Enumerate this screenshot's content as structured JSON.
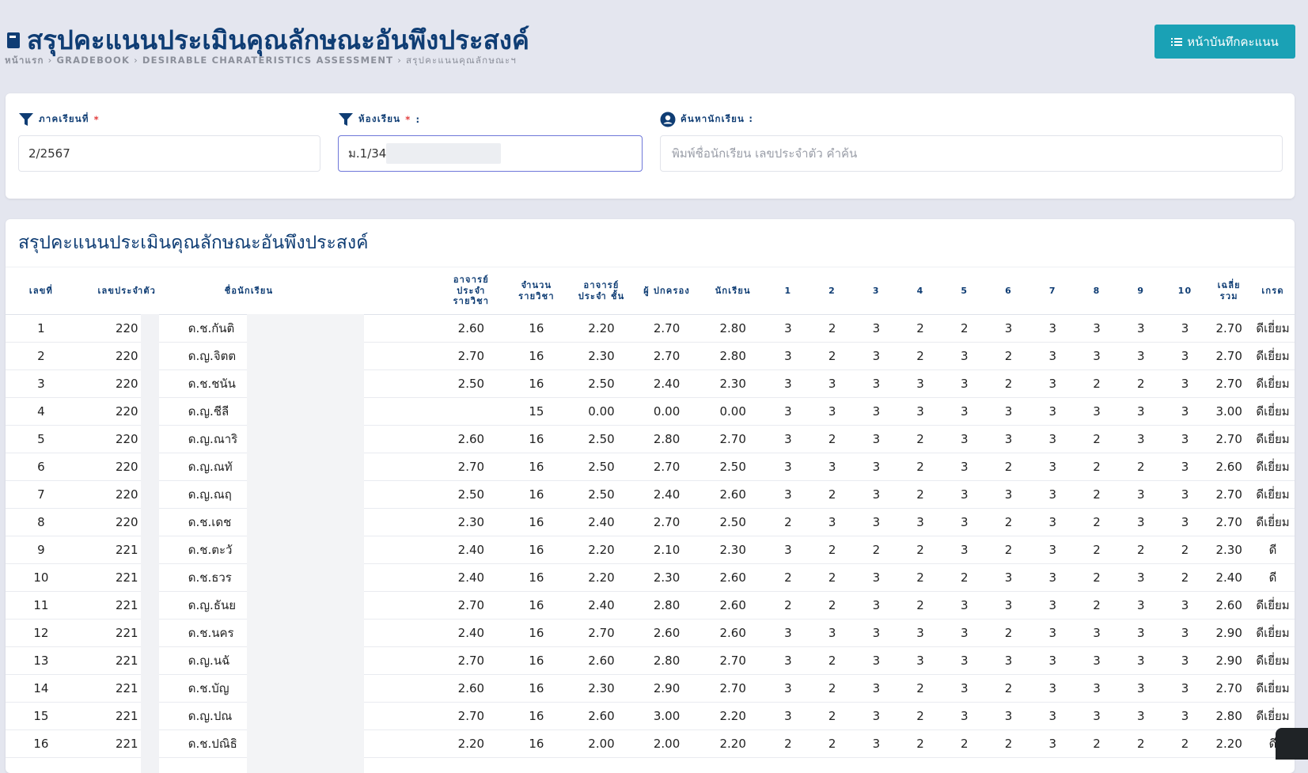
{
  "header": {
    "title": "สรุปคะแนนประเมินคุณลักษณะอันพึงประสงค์",
    "breadcrumb": [
      "หน้าแรก",
      "GRADEBOOK",
      "DESIRABLE CHARATERISTICS ASSESSMENT",
      "สรุปคะแนนคุณลักษณะฯ"
    ],
    "gradebook_button": "หน้าบันทึกคะแนน"
  },
  "filters": {
    "semester": {
      "label": "ภาคเรียนที่",
      "required_mark": "*",
      "value": "2/2567"
    },
    "classroom": {
      "label": "ห้องเรียน",
      "required_mark": "*",
      "suffix": ":",
      "value": "ม.1/34"
    },
    "search": {
      "label": "ค้นหานักเรียน :",
      "placeholder": "พิมพ์ชื่อนักเรียน เลขประจำตัว คำค้น"
    }
  },
  "table": {
    "title": "สรุปคะแนนประเมินคุณลักษณะอันพึงประสงค์",
    "columns": [
      "เลขที่",
      "เลขประจำตัว",
      "ชื่อนักเรียน",
      "อาจารย์ ประจำ รายวิชา",
      "จำนวน รายวิชา",
      "อาจารย์ ประจำ ชั้น",
      "ผู้ ปกครอง",
      "นักเรียน",
      "1",
      "2",
      "3",
      "4",
      "5",
      "6",
      "7",
      "8",
      "9",
      "10",
      "เฉลี่ย รวม",
      "เกรด"
    ],
    "rows": [
      [
        "1",
        "220",
        "ด.ช.กันติ",
        "2.60",
        "16",
        "2.20",
        "2.70",
        "2.80",
        "3",
        "2",
        "3",
        "2",
        "2",
        "3",
        "3",
        "3",
        "3",
        "3",
        "2.70",
        "ดีเยี่ยม"
      ],
      [
        "2",
        "220",
        "ด.ญ.จิตต",
        "2.70",
        "16",
        "2.30",
        "2.70",
        "2.80",
        "3",
        "2",
        "3",
        "2",
        "3",
        "2",
        "3",
        "3",
        "3",
        "3",
        "2.70",
        "ดีเยี่ยม"
      ],
      [
        "3",
        "220",
        "ด.ช.ชนัน",
        "2.50",
        "16",
        "2.50",
        "2.40",
        "2.30",
        "3",
        "3",
        "3",
        "3",
        "3",
        "2",
        "3",
        "2",
        "2",
        "3",
        "2.70",
        "ดีเยี่ยม"
      ],
      [
        "4",
        "220",
        "ด.ญ.ชีลี",
        "",
        "15",
        "0.00",
        "0.00",
        "0.00",
        "3",
        "3",
        "3",
        "3",
        "3",
        "3",
        "3",
        "3",
        "3",
        "3",
        "3.00",
        "ดีเยี่ยม"
      ],
      [
        "5",
        "220",
        "ด.ญ.ณาริ",
        "2.60",
        "16",
        "2.50",
        "2.80",
        "2.70",
        "3",
        "2",
        "3",
        "2",
        "3",
        "3",
        "3",
        "2",
        "3",
        "3",
        "2.70",
        "ดีเยี่ยม"
      ],
      [
        "6",
        "220",
        "ด.ญ.ณทั",
        "2.70",
        "16",
        "2.50",
        "2.70",
        "2.50",
        "3",
        "3",
        "3",
        "2",
        "3",
        "2",
        "3",
        "2",
        "2",
        "3",
        "2.60",
        "ดีเยี่ยม"
      ],
      [
        "7",
        "220",
        "ด.ญ.ณฤ",
        "2.50",
        "16",
        "2.50",
        "2.40",
        "2.60",
        "3",
        "2",
        "3",
        "2",
        "3",
        "3",
        "3",
        "2",
        "3",
        "3",
        "2.70",
        "ดีเยี่ยม"
      ],
      [
        "8",
        "220",
        "ด.ช.เดช",
        "2.30",
        "16",
        "2.40",
        "2.70",
        "2.50",
        "2",
        "3",
        "3",
        "3",
        "3",
        "2",
        "3",
        "2",
        "3",
        "3",
        "2.70",
        "ดีเยี่ยม"
      ],
      [
        "9",
        "221",
        "ด.ช.ตะวั",
        "2.40",
        "16",
        "2.20",
        "2.10",
        "2.30",
        "3",
        "2",
        "2",
        "2",
        "3",
        "2",
        "3",
        "2",
        "2",
        "2",
        "2.30",
        "ดี"
      ],
      [
        "10",
        "221",
        "ด.ช.ธวร",
        "2.40",
        "16",
        "2.20",
        "2.30",
        "2.60",
        "2",
        "2",
        "3",
        "2",
        "2",
        "3",
        "3",
        "2",
        "3",
        "2",
        "2.40",
        "ดี"
      ],
      [
        "11",
        "221",
        "ด.ญ.ธันย",
        "2.70",
        "16",
        "2.40",
        "2.80",
        "2.60",
        "2",
        "2",
        "3",
        "2",
        "3",
        "3",
        "3",
        "2",
        "3",
        "3",
        "2.60",
        "ดีเยี่ยม"
      ],
      [
        "12",
        "221",
        "ด.ช.นคร",
        "2.40",
        "16",
        "2.70",
        "2.60",
        "2.60",
        "3",
        "3",
        "3",
        "3",
        "3",
        "2",
        "3",
        "3",
        "3",
        "3",
        "2.90",
        "ดีเยี่ยม"
      ],
      [
        "13",
        "221",
        "ด.ญ.นฉั",
        "2.70",
        "16",
        "2.60",
        "2.80",
        "2.70",
        "3",
        "2",
        "3",
        "3",
        "3",
        "3",
        "3",
        "3",
        "3",
        "3",
        "2.90",
        "ดีเยี่ยม"
      ],
      [
        "14",
        "221",
        "ด.ช.บัญ",
        "2.60",
        "16",
        "2.30",
        "2.90",
        "2.70",
        "3",
        "2",
        "3",
        "2",
        "3",
        "2",
        "3",
        "3",
        "3",
        "3",
        "2.70",
        "ดีเยี่ยม"
      ],
      [
        "15",
        "221",
        "ด.ญ.ปณ",
        "2.70",
        "16",
        "2.60",
        "3.00",
        "2.20",
        "3",
        "2",
        "3",
        "2",
        "3",
        "3",
        "3",
        "3",
        "3",
        "3",
        "2.80",
        "ดีเยี่ยม"
      ],
      [
        "16",
        "221",
        "ด.ช.ปณิธิ",
        "2.20",
        "16",
        "2.00",
        "2.00",
        "2.20",
        "2",
        "2",
        "3",
        "2",
        "2",
        "2",
        "3",
        "2",
        "2",
        "2",
        "2.20",
        "ดี"
      ]
    ]
  },
  "colors": {
    "primary": "#0f3d74",
    "accent": "#1aa1b5",
    "background": "#e4e6ef",
    "required": "#e23b3b"
  },
  "icons": [
    "book-icon",
    "filter-icon",
    "user-circle-icon",
    "list-icon",
    "chevron-right-icon"
  ]
}
